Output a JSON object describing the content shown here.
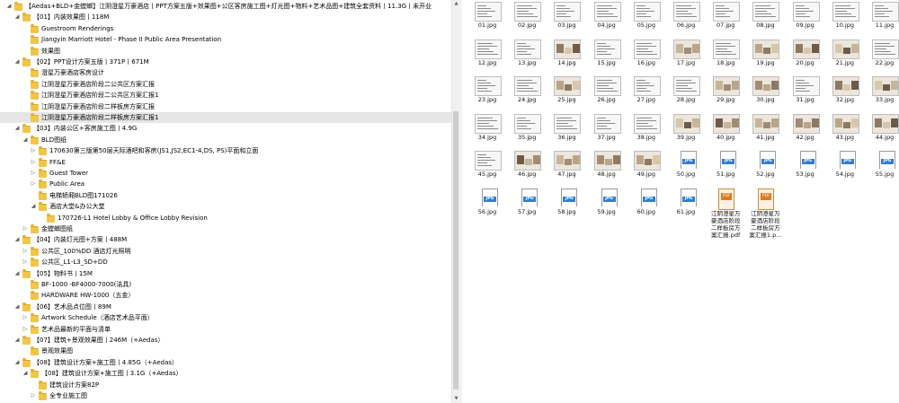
{
  "tree": {
    "items": [
      {
        "label": "【Aedas+BLD+金螳螂】江阴澄星万豪酒店丨PPT方案五版+效果图+公区客房施工图+灯光图+物料+艺术品图+建筑全套资料丨11.3G丨未开业",
        "depth": 0,
        "expanded": true,
        "selected": false
      },
      {
        "label": "【01】内装效果图丨118M",
        "depth": 1,
        "expanded": true,
        "selected": false
      },
      {
        "label": "Guestroom Renderings",
        "depth": 2,
        "expanded": null,
        "selected": false
      },
      {
        "label": "Jiangyin Marriott Hotel - Phase II Public Area Presentation",
        "depth": 2,
        "expanded": null,
        "selected": false
      },
      {
        "label": "效果图",
        "depth": 2,
        "expanded": null,
        "selected": false
      },
      {
        "label": "【02】PPT设计方案五版丨371P丨671M",
        "depth": 1,
        "expanded": true,
        "selected": false
      },
      {
        "label": "澄星万豪酒店客房设计",
        "depth": 2,
        "expanded": null,
        "selected": false
      },
      {
        "label": "江阴澄星万豪酒店阶段二公共区方案汇报",
        "depth": 2,
        "expanded": null,
        "selected": false
      },
      {
        "label": "江阴澄星万豪酒店阶段二公共区方案汇报1",
        "depth": 2,
        "expanded": null,
        "selected": false
      },
      {
        "label": "江阴澄星万豪酒店阶段二样板房方案汇报",
        "depth": 2,
        "expanded": null,
        "selected": false
      },
      {
        "label": "江阴澄星万豪酒店阶段二样板房方案汇报1",
        "depth": 2,
        "expanded": null,
        "selected": true
      },
      {
        "label": "【03】内装公区+客房施工图丨4.9G",
        "depth": 1,
        "expanded": true,
        "selected": false
      },
      {
        "label": "BLD图纸",
        "depth": 2,
        "expanded": true,
        "selected": false
      },
      {
        "label": "170630第三版第50层天际酒吧和客房(JS1,JS2,EC1-4,DS, PS)平面和立面",
        "depth": 3,
        "expanded": false,
        "selected": false
      },
      {
        "label": "FF&E",
        "depth": 3,
        "expanded": false,
        "selected": false
      },
      {
        "label": "Guest Tower",
        "depth": 3,
        "expanded": false,
        "selected": false
      },
      {
        "label": "Public Area",
        "depth": 3,
        "expanded": false,
        "selected": false
      },
      {
        "label": "电梯轿厢BLD图171026",
        "depth": 3,
        "expanded": null,
        "selected": false
      },
      {
        "label": "酒店大堂&办公大堂",
        "depth": 3,
        "expanded": true,
        "selected": false
      },
      {
        "label": "170726-L1 Hotel Lobby & Office Lobby Revision",
        "depth": 4,
        "expanded": null,
        "selected": false
      },
      {
        "label": "金螳螂图纸",
        "depth": 2,
        "expanded": false,
        "selected": false
      },
      {
        "label": "【04】内装灯光图+方案丨488M",
        "depth": 1,
        "expanded": true,
        "selected": false
      },
      {
        "label": "公共区_100%DD 酒店灯光照明",
        "depth": 2,
        "expanded": false,
        "selected": false
      },
      {
        "label": "公共区_L1-L3_SD+DD",
        "depth": 2,
        "expanded": false,
        "selected": false
      },
      {
        "label": "【05】物料书丨15M",
        "depth": 1,
        "expanded": true,
        "selected": false
      },
      {
        "label": "BF-1000 -BF4000-7000(洁具)",
        "depth": 2,
        "expanded": null,
        "selected": false
      },
      {
        "label": "HARDWARE HW-1000（五金）",
        "depth": 2,
        "expanded": null,
        "selected": false
      },
      {
        "label": "【06】艺术品点位图丨89M",
        "depth": 1,
        "expanded": true,
        "selected": false
      },
      {
        "label": "Artwork Schedule（酒店艺术品平面）",
        "depth": 2,
        "expanded": false,
        "selected": false
      },
      {
        "label": "艺术品最新的平面与清单",
        "depth": 2,
        "expanded": false,
        "selected": false
      },
      {
        "label": "【07】建筑+景观效果图丨246M（+Aedas）",
        "depth": 1,
        "expanded": true,
        "selected": false
      },
      {
        "label": "景观效果图",
        "depth": 2,
        "expanded": null,
        "selected": false
      },
      {
        "label": "【08】建筑设计方案+施工图丨4.85G（+Aedas）",
        "depth": 1,
        "expanded": true,
        "selected": false
      },
      {
        "label": "【08】建筑设计方案+施工图丨3.1G（+Aedas）",
        "depth": 2,
        "expanded": true,
        "selected": false
      },
      {
        "label": "建筑设计方案82P",
        "depth": 3,
        "expanded": null,
        "selected": false
      },
      {
        "label": "全专业施工图",
        "depth": 3,
        "expanded": false,
        "selected": false
      }
    ]
  },
  "files": [
    {
      "name": "01.jpg",
      "kind": "doc"
    },
    {
      "name": "02.jpg",
      "kind": "doc"
    },
    {
      "name": "03.jpg",
      "kind": "doc"
    },
    {
      "name": "04.jpg",
      "kind": "doc"
    },
    {
      "name": "05.jpg",
      "kind": "doc"
    },
    {
      "name": "06.jpg",
      "kind": "doc"
    },
    {
      "name": "07.jpg",
      "kind": "doc"
    },
    {
      "name": "08.jpg",
      "kind": "doc"
    },
    {
      "name": "09.jpg",
      "kind": "doc"
    },
    {
      "name": "10.jpg",
      "kind": "doc"
    },
    {
      "name": "11.jpg",
      "kind": "doc"
    },
    {
      "name": "12.jpg",
      "kind": "doc"
    },
    {
      "name": "13.jpg",
      "kind": "doc"
    },
    {
      "name": "14.jpg",
      "kind": "img"
    },
    {
      "name": "15.jpg",
      "kind": "doc"
    },
    {
      "name": "16.jpg",
      "kind": "doc"
    },
    {
      "name": "17.jpg",
      "kind": "img"
    },
    {
      "name": "18.jpg",
      "kind": "doc"
    },
    {
      "name": "19.jpg",
      "kind": "img"
    },
    {
      "name": "20.jpg",
      "kind": "img"
    },
    {
      "name": "21.jpg",
      "kind": "img"
    },
    {
      "name": "22.jpg",
      "kind": "doc"
    },
    {
      "name": "23.jpg",
      "kind": "doc"
    },
    {
      "name": "24.jpg",
      "kind": "doc"
    },
    {
      "name": "25.jpg",
      "kind": "img"
    },
    {
      "name": "26.jpg",
      "kind": "doc"
    },
    {
      "name": "27.jpg",
      "kind": "doc"
    },
    {
      "name": "28.jpg",
      "kind": "doc"
    },
    {
      "name": "29.jpg",
      "kind": "img"
    },
    {
      "name": "30.jpg",
      "kind": "img"
    },
    {
      "name": "31.jpg",
      "kind": "doc"
    },
    {
      "name": "32.jpg",
      "kind": "img"
    },
    {
      "name": "33.jpg",
      "kind": "img"
    },
    {
      "name": "34.jpg",
      "kind": "doc"
    },
    {
      "name": "35.jpg",
      "kind": "doc"
    },
    {
      "name": "36.jpg",
      "kind": "doc"
    },
    {
      "name": "37.jpg",
      "kind": "doc"
    },
    {
      "name": "38.jpg",
      "kind": "doc"
    },
    {
      "name": "39.jpg",
      "kind": "img"
    },
    {
      "name": "40.jpg",
      "kind": "img"
    },
    {
      "name": "41.jpg",
      "kind": "img"
    },
    {
      "name": "42.jpg",
      "kind": "img"
    },
    {
      "name": "43.jpg",
      "kind": "img"
    },
    {
      "name": "44.jpg",
      "kind": "img"
    },
    {
      "name": "45.jpg",
      "kind": "doc"
    },
    {
      "name": "46.jpg",
      "kind": "img"
    },
    {
      "name": "47.jpg",
      "kind": "img"
    },
    {
      "name": "48.jpg",
      "kind": "img"
    },
    {
      "name": "49.jpg",
      "kind": "img"
    },
    {
      "name": "50.jpg",
      "kind": "jpgicon"
    },
    {
      "name": "51.jpg",
      "kind": "jpgicon"
    },
    {
      "name": "52.jpg",
      "kind": "jpgicon"
    },
    {
      "name": "53.jpg",
      "kind": "jpgicon"
    },
    {
      "name": "54.jpg",
      "kind": "jpgicon"
    },
    {
      "name": "55.jpg",
      "kind": "jpgicon"
    },
    {
      "name": "56.jpg",
      "kind": "jpgicon"
    },
    {
      "name": "57.jpg",
      "kind": "jpgicon"
    },
    {
      "name": "58.jpg",
      "kind": "jpgicon"
    },
    {
      "name": "59.jpg",
      "kind": "jpgicon"
    },
    {
      "name": "60.jpg",
      "kind": "jpgicon"
    },
    {
      "name": "61.jpg",
      "kind": "jpgicon"
    },
    {
      "name": "江阴澄星万豪酒店阶段二样板房方案汇报.pdf",
      "kind": "pdf",
      "caption_lines": [
        "江阴澄星万",
        "豪酒店阶段",
        "二样板房方",
        "案汇报.pdf"
      ]
    },
    {
      "name": "江阴澄星万豪酒店阶段二样板房方案汇报1.pdf",
      "kind": "pdf",
      "caption_lines": [
        "江阴澄星万",
        "豪酒店阶段",
        "二样板房方",
        "案汇报1.p..."
      ]
    }
  ],
  "icons": {
    "jpg_badge": "JPG",
    "pdf_badge": "PDF"
  },
  "colors": {
    "folder": "#f0c64a",
    "selection": "#e6e6e6",
    "jpg_badge": "#2f7fcf",
    "pdf_badge": "#e07b1e"
  }
}
